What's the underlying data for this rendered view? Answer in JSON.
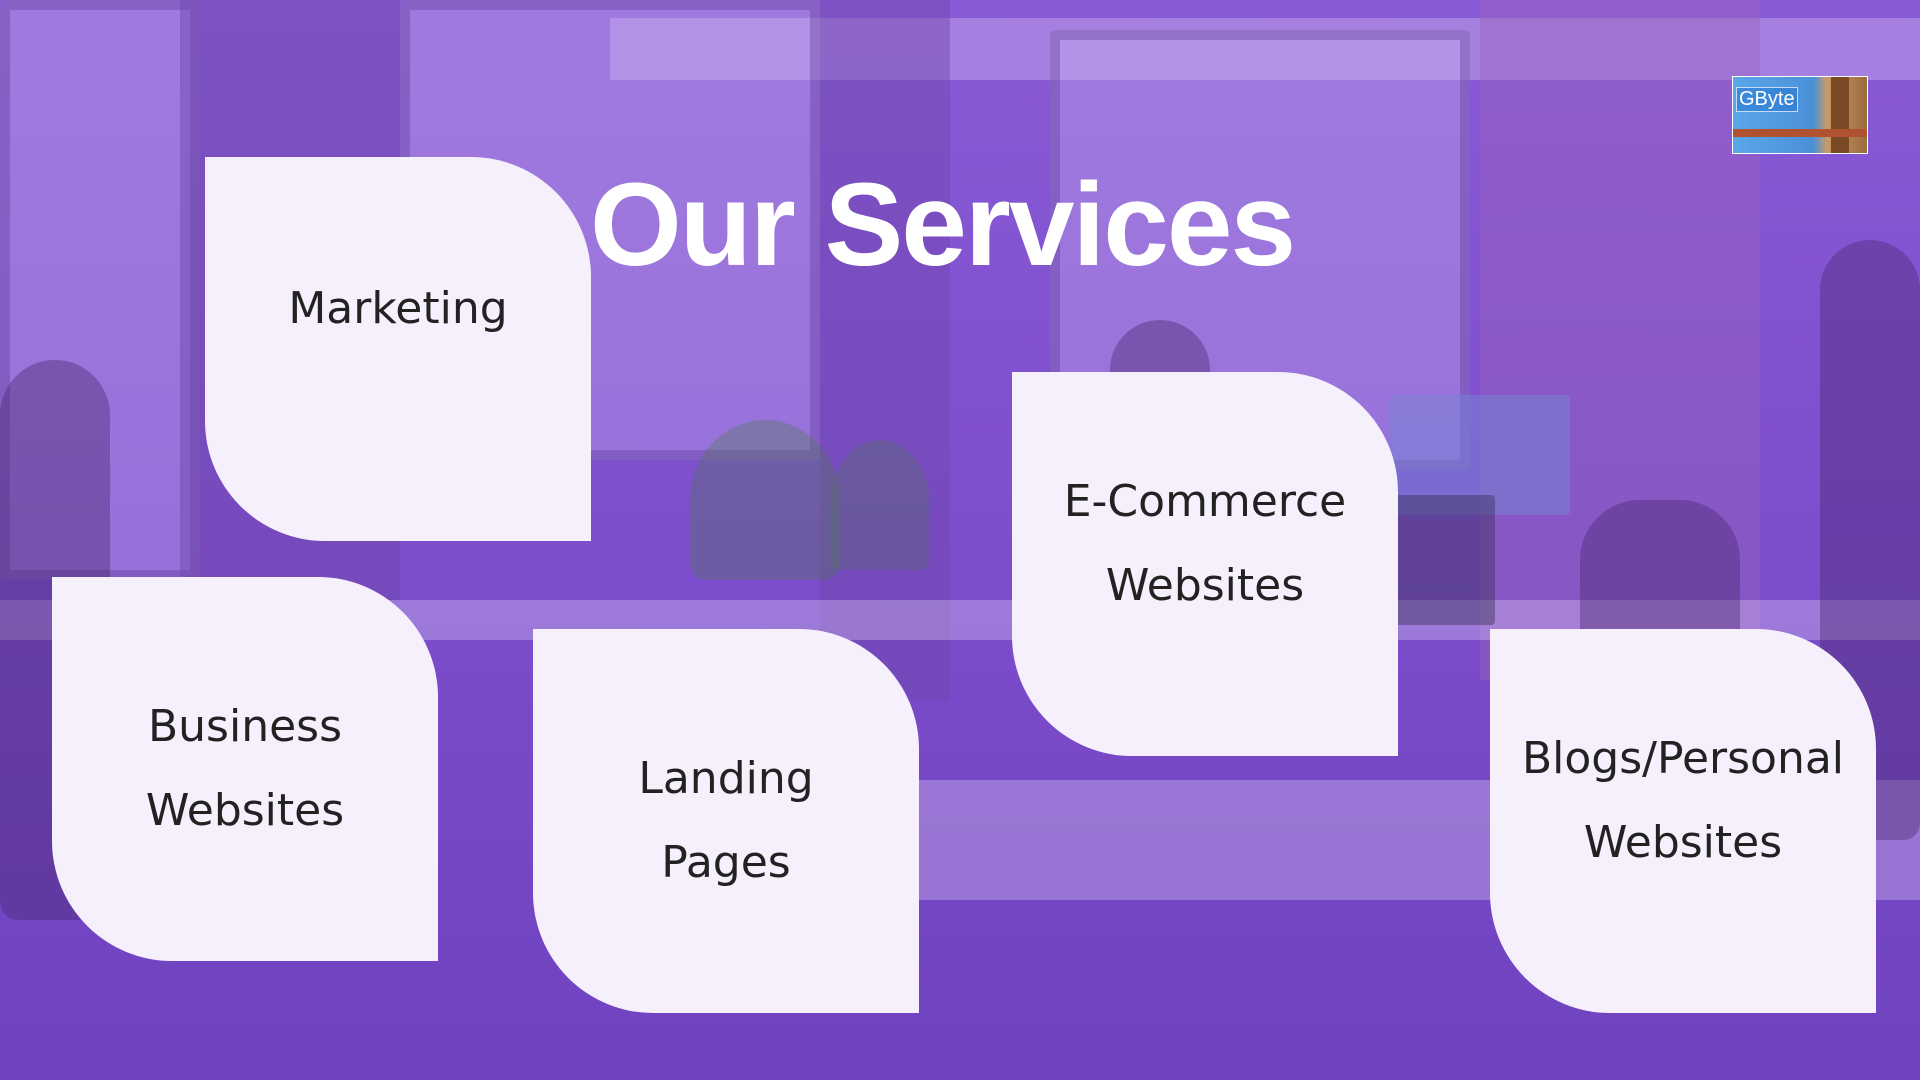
{
  "title": "Our Services",
  "logo": {
    "text": "GByte"
  },
  "services": [
    {
      "line1": "Marketing",
      "line2": ""
    },
    {
      "line1": "Business",
      "line2": "Websites"
    },
    {
      "line1": "Landing",
      "line2": "Pages"
    },
    {
      "line1": "E-Commerce",
      "line2": "Websites"
    },
    {
      "line1": "Blogs/Personal",
      "line2": "Websites"
    }
  ],
  "colors": {
    "background_tint": "#7e4fce",
    "card": "#f6f0fd",
    "title": "#ffffff",
    "card_text": "#222222"
  }
}
